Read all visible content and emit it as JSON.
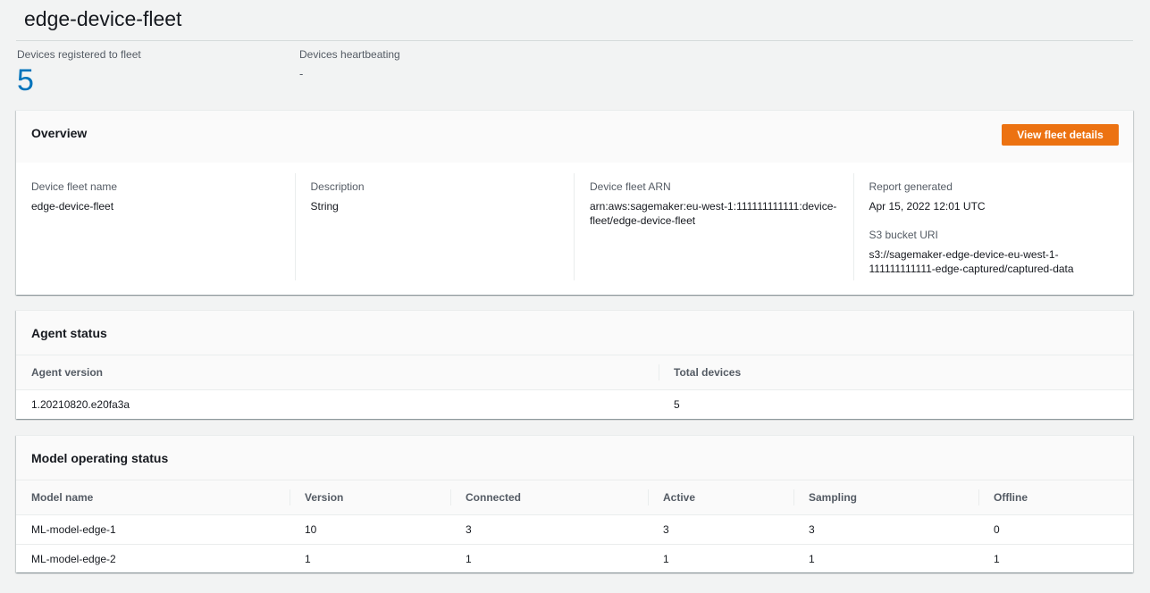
{
  "page": {
    "title": "edge-device-fleet"
  },
  "metrics": {
    "registered": {
      "label": "Devices registered to fleet",
      "value": "5"
    },
    "heartbeating": {
      "label": "Devices heartbeating",
      "value": "-"
    }
  },
  "overview": {
    "title": "Overview",
    "view_button": "View fleet details",
    "fleet_name": {
      "label": "Device fleet name",
      "value": "edge-device-fleet"
    },
    "description": {
      "label": "Description",
      "value": "String"
    },
    "arn": {
      "label": "Device fleet ARN",
      "value": "arn:aws:sagemaker:eu-west-1:111111111111:device-fleet/edge-device-fleet"
    },
    "report": {
      "label": "Report generated",
      "value": "Apr 15, 2022 12:01 UTC"
    },
    "s3": {
      "label": "S3 bucket URI",
      "value": "s3://sagemaker-edge-device-eu-west-1-111111111111-edge-captured/captured-data"
    }
  },
  "agent_status": {
    "title": "Agent status",
    "columns": [
      "Agent version",
      "Total devices"
    ],
    "rows": [
      [
        "1.20210820.e20fa3a",
        "5"
      ]
    ]
  },
  "model_status": {
    "title": "Model operating status",
    "columns": [
      "Model name",
      "Version",
      "Connected",
      "Active",
      "Sampling",
      "Offline"
    ],
    "rows": [
      [
        "ML-model-edge-1",
        "10",
        "3",
        "3",
        "3",
        "0"
      ],
      [
        "ML-model-edge-2",
        "1",
        "1",
        "1",
        "1",
        "1"
      ]
    ]
  },
  "colors": {
    "accent_orange": "#ec7211",
    "link_blue": "#0073bb",
    "background": "#f2f3f3"
  }
}
